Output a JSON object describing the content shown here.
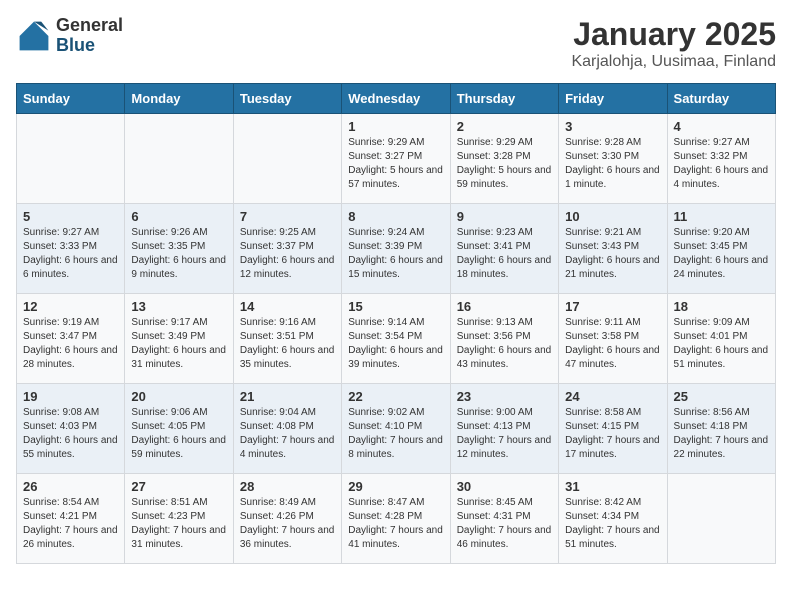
{
  "logo": {
    "general": "General",
    "blue": "Blue"
  },
  "title": "January 2025",
  "subtitle": "Karjalohja, Uusimaa, Finland",
  "days_of_week": [
    "Sunday",
    "Monday",
    "Tuesday",
    "Wednesday",
    "Thursday",
    "Friday",
    "Saturday"
  ],
  "weeks": [
    [
      {
        "day": "",
        "info": ""
      },
      {
        "day": "",
        "info": ""
      },
      {
        "day": "",
        "info": ""
      },
      {
        "day": "1",
        "info": "Sunrise: 9:29 AM\nSunset: 3:27 PM\nDaylight: 5 hours and 57 minutes."
      },
      {
        "day": "2",
        "info": "Sunrise: 9:29 AM\nSunset: 3:28 PM\nDaylight: 5 hours and 59 minutes."
      },
      {
        "day": "3",
        "info": "Sunrise: 9:28 AM\nSunset: 3:30 PM\nDaylight: 6 hours and 1 minute."
      },
      {
        "day": "4",
        "info": "Sunrise: 9:27 AM\nSunset: 3:32 PM\nDaylight: 6 hours and 4 minutes."
      }
    ],
    [
      {
        "day": "5",
        "info": "Sunrise: 9:27 AM\nSunset: 3:33 PM\nDaylight: 6 hours and 6 minutes."
      },
      {
        "day": "6",
        "info": "Sunrise: 9:26 AM\nSunset: 3:35 PM\nDaylight: 6 hours and 9 minutes."
      },
      {
        "day": "7",
        "info": "Sunrise: 9:25 AM\nSunset: 3:37 PM\nDaylight: 6 hours and 12 minutes."
      },
      {
        "day": "8",
        "info": "Sunrise: 9:24 AM\nSunset: 3:39 PM\nDaylight: 6 hours and 15 minutes."
      },
      {
        "day": "9",
        "info": "Sunrise: 9:23 AM\nSunset: 3:41 PM\nDaylight: 6 hours and 18 minutes."
      },
      {
        "day": "10",
        "info": "Sunrise: 9:21 AM\nSunset: 3:43 PM\nDaylight: 6 hours and 21 minutes."
      },
      {
        "day": "11",
        "info": "Sunrise: 9:20 AM\nSunset: 3:45 PM\nDaylight: 6 hours and 24 minutes."
      }
    ],
    [
      {
        "day": "12",
        "info": "Sunrise: 9:19 AM\nSunset: 3:47 PM\nDaylight: 6 hours and 28 minutes."
      },
      {
        "day": "13",
        "info": "Sunrise: 9:17 AM\nSunset: 3:49 PM\nDaylight: 6 hours and 31 minutes."
      },
      {
        "day": "14",
        "info": "Sunrise: 9:16 AM\nSunset: 3:51 PM\nDaylight: 6 hours and 35 minutes."
      },
      {
        "day": "15",
        "info": "Sunrise: 9:14 AM\nSunset: 3:54 PM\nDaylight: 6 hours and 39 minutes."
      },
      {
        "day": "16",
        "info": "Sunrise: 9:13 AM\nSunset: 3:56 PM\nDaylight: 6 hours and 43 minutes."
      },
      {
        "day": "17",
        "info": "Sunrise: 9:11 AM\nSunset: 3:58 PM\nDaylight: 6 hours and 47 minutes."
      },
      {
        "day": "18",
        "info": "Sunrise: 9:09 AM\nSunset: 4:01 PM\nDaylight: 6 hours and 51 minutes."
      }
    ],
    [
      {
        "day": "19",
        "info": "Sunrise: 9:08 AM\nSunset: 4:03 PM\nDaylight: 6 hours and 55 minutes."
      },
      {
        "day": "20",
        "info": "Sunrise: 9:06 AM\nSunset: 4:05 PM\nDaylight: 6 hours and 59 minutes."
      },
      {
        "day": "21",
        "info": "Sunrise: 9:04 AM\nSunset: 4:08 PM\nDaylight: 7 hours and 4 minutes."
      },
      {
        "day": "22",
        "info": "Sunrise: 9:02 AM\nSunset: 4:10 PM\nDaylight: 7 hours and 8 minutes."
      },
      {
        "day": "23",
        "info": "Sunrise: 9:00 AM\nSunset: 4:13 PM\nDaylight: 7 hours and 12 minutes."
      },
      {
        "day": "24",
        "info": "Sunrise: 8:58 AM\nSunset: 4:15 PM\nDaylight: 7 hours and 17 minutes."
      },
      {
        "day": "25",
        "info": "Sunrise: 8:56 AM\nSunset: 4:18 PM\nDaylight: 7 hours and 22 minutes."
      }
    ],
    [
      {
        "day": "26",
        "info": "Sunrise: 8:54 AM\nSunset: 4:21 PM\nDaylight: 7 hours and 26 minutes."
      },
      {
        "day": "27",
        "info": "Sunrise: 8:51 AM\nSunset: 4:23 PM\nDaylight: 7 hours and 31 minutes."
      },
      {
        "day": "28",
        "info": "Sunrise: 8:49 AM\nSunset: 4:26 PM\nDaylight: 7 hours and 36 minutes."
      },
      {
        "day": "29",
        "info": "Sunrise: 8:47 AM\nSunset: 4:28 PM\nDaylight: 7 hours and 41 minutes."
      },
      {
        "day": "30",
        "info": "Sunrise: 8:45 AM\nSunset: 4:31 PM\nDaylight: 7 hours and 46 minutes."
      },
      {
        "day": "31",
        "info": "Sunrise: 8:42 AM\nSunset: 4:34 PM\nDaylight: 7 hours and 51 minutes."
      },
      {
        "day": "",
        "info": ""
      }
    ]
  ]
}
